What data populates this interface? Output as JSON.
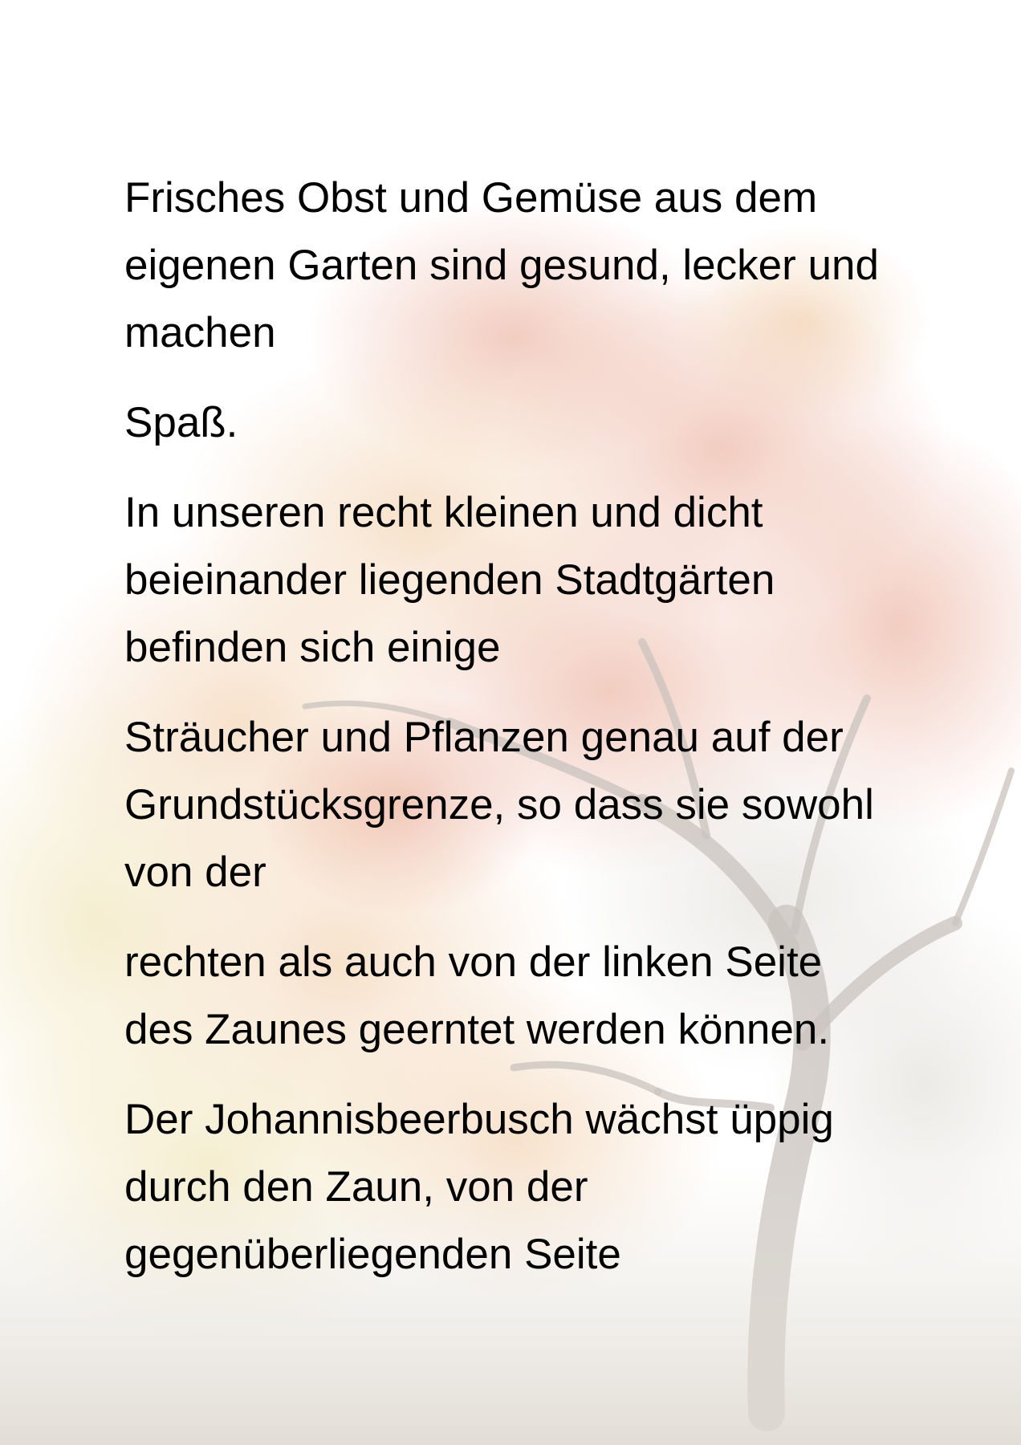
{
  "document": {
    "paragraphs": [
      {
        "lines": [
          "Frisches Obst und Gemüse aus dem",
          "eigenen Garten sind gesund, lecker und",
          "machen"
        ]
      },
      {
        "lines": [
          "Spaß."
        ]
      },
      {
        "lines": [
          "In unseren recht kleinen und dicht",
          "beieinander liegenden Stadtgärten",
          "befinden sich einige"
        ]
      },
      {
        "lines": [
          "Sträucher und Pflanzen genau auf der",
          "Grundstücksgrenze, so dass sie sowohl",
          "von der"
        ]
      },
      {
        "lines": [
          "rechten als auch von der linken Seite",
          "des Zaunes geerntet werden können."
        ]
      },
      {
        "lines": [
          "Der Johannisbeerbusch wächst üppig",
          "durch den Zaun, von der",
          "gegenüberliegenden Seite"
        ]
      }
    ]
  },
  "background": {
    "icon": "autumn-tree-image",
    "colors": {
      "foliage_red": "#e8a38c",
      "foliage_orange": "#f0c9a0",
      "foliage_yellow": "#efe2b0",
      "trunk": "#c9c3bd",
      "sky": "#ffffff"
    }
  }
}
